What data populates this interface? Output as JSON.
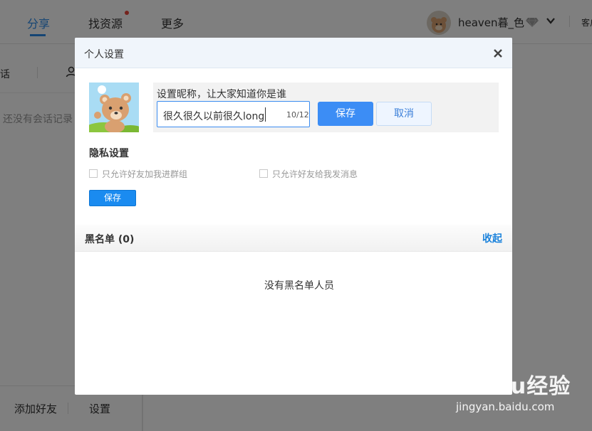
{
  "topbar": {
    "tabs": [
      {
        "label": "分享",
        "active": true
      },
      {
        "label": "找资源",
        "has_dot": true
      },
      {
        "label": "更多"
      }
    ],
    "username": "heaven暮_色",
    "right_text": "客户"
  },
  "sidebar": {
    "tab_fragment": "话",
    "empty_text": "还没有会话记录",
    "bottom": {
      "add_friend": "添加好友",
      "settings": "设置"
    }
  },
  "dialog": {
    "title": "个人设置",
    "nickname": {
      "prompt": "设置昵称，让大家知道你是谁",
      "value": "很久很久以前很久long",
      "count": "10/12",
      "save": "保存",
      "cancel": "取消"
    },
    "privacy": {
      "title": "隐私设置",
      "options": [
        {
          "label": "只允许好友加我进群组",
          "checked": false
        },
        {
          "label": "只允许好友给我发消息",
          "checked": false
        }
      ],
      "save": "保存"
    },
    "blacklist": {
      "title": "黑名单 (0)",
      "collapse": "收起",
      "empty": "没有黑名单人员"
    }
  },
  "watermark": {
    "text": "Baidu经验",
    "sub": "jingyan.baidu.com"
  },
  "colors": {
    "accent": "#3c8df5",
    "active_tab": "#2a8ae8",
    "link": "#1c83dc"
  }
}
